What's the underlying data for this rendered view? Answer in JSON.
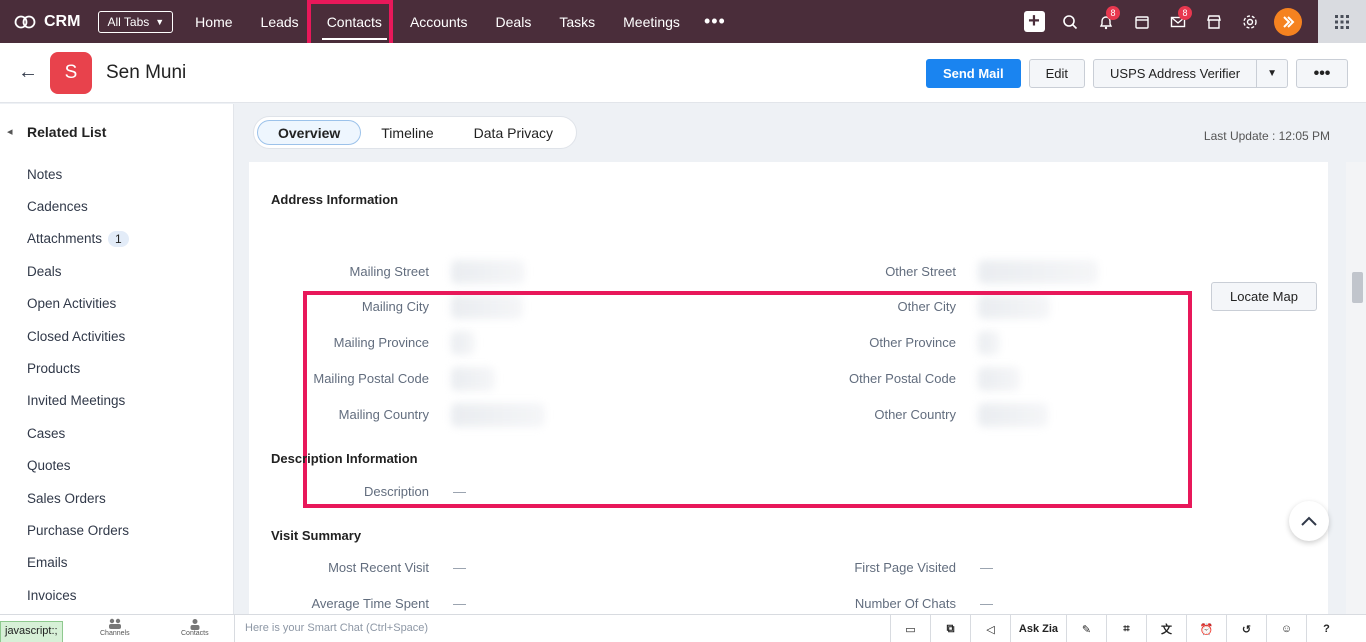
{
  "nav": {
    "brand": "CRM",
    "all_tabs": "All Tabs",
    "links": [
      "Home",
      "Leads",
      "Contacts",
      "Accounts",
      "Deals",
      "Tasks",
      "Meetings"
    ],
    "more": "•••",
    "notifications_count": "8",
    "mail_count": "8",
    "accent": "#4a2d3a"
  },
  "record": {
    "avatar_letter": "S",
    "name": "Sen Muni",
    "send_mail": "Send Mail",
    "edit": "Edit",
    "usps": "USPS Address Verifier",
    "more": "•••"
  },
  "sidebar": {
    "title": "Related List",
    "items": [
      "Notes",
      "Cadences",
      "Attachments",
      "Deals",
      "Open Activities",
      "Closed Activities",
      "Products",
      "Invited Meetings",
      "Cases",
      "Quotes",
      "Sales Orders",
      "Purchase Orders",
      "Emails",
      "Invoices"
    ],
    "attachments_count": "1"
  },
  "tabs": {
    "items": [
      "Overview",
      "Timeline",
      "Data Privacy"
    ],
    "last_update": "Last Update : 12:05 PM"
  },
  "address": {
    "title": "Address Information",
    "locate_map": "Locate Map",
    "left_labels": [
      "Mailing Street",
      "Mailing City",
      "Mailing Province",
      "Mailing Postal Code",
      "Mailing Country"
    ],
    "right_labels": [
      "Other Street",
      "Other City",
      "Other Province",
      "Other Postal Code",
      "Other Country"
    ]
  },
  "description": {
    "title": "Description Information",
    "label": "Description",
    "value": "—"
  },
  "visit": {
    "title": "Visit Summary",
    "most_recent_visit": "Most Recent Visit",
    "most_recent_visit_value": "—",
    "first_page_visited": "First Page Visited",
    "first_page_visited_value": "—",
    "average_time_spent": "Average Time Spent",
    "average_time_spent_value": "—",
    "number_of_chats": "Number Of Chats",
    "number_of_chats_value": "—"
  },
  "bottom": {
    "status": "javascript:;",
    "channels": "Channels",
    "contacts": "Contacts",
    "smart_chat": "Here is your Smart Chat (Ctrl+Space)",
    "ask_zia": "Ask Zia"
  }
}
